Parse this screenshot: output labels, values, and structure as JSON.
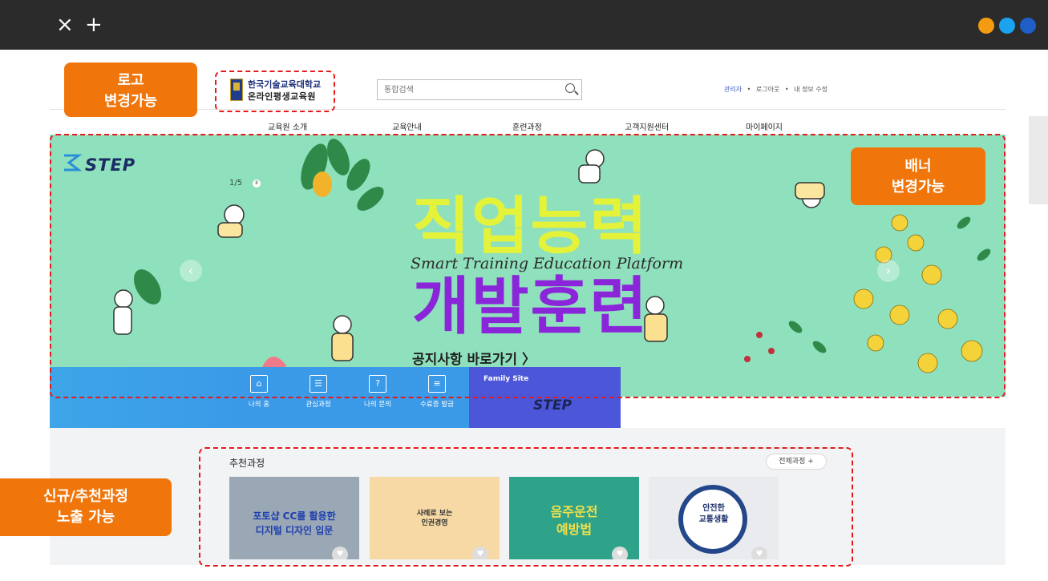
{
  "browser": {
    "close_icon": "×",
    "new_tab_icon": "+",
    "dots": [
      "#f39c12",
      "#1ba3ef",
      "#1e5ec6"
    ]
  },
  "header": {
    "logo_line1": "한국기술교육대학교",
    "logo_line2": "온라인평생교육원",
    "search_placeholder": "통합검색",
    "util_links": [
      "관리자",
      "•",
      "로그아웃",
      "•",
      "내 정보 수정"
    ],
    "gnb": [
      "교육원 소개",
      "교육안내",
      "훈련과정",
      "고객지원센터",
      "마이페이지"
    ]
  },
  "banner": {
    "brand": "STEP",
    "pager": "1/5",
    "pause_icon": "II",
    "prev_icon": "‹",
    "next_icon": "›",
    "headline1": "직업능력",
    "script": "Smart Training Education Platform",
    "headline2": "개발훈련",
    "notice_link": "공지사항 바로가기 〉"
  },
  "quick_menu": {
    "items": [
      {
        "label": "나의 홈",
        "icon": "home-icon",
        "glyph": "⌂"
      },
      {
        "label": "관심과정",
        "icon": "bookmark-icon",
        "glyph": "☰"
      },
      {
        "label": "나의 문의",
        "icon": "question-icon",
        "glyph": "?"
      },
      {
        "label": "수료증 발급",
        "icon": "certificate-icon",
        "glyph": "≡"
      }
    ],
    "family_title": "Family Site",
    "family_logo": "STEP"
  },
  "recommend": {
    "title": "추천과정",
    "all_button": "전체과정 +",
    "cards": [
      {
        "line1": "포토샵 CC를 활용한",
        "line2": "디지털 디자인 입문",
        "bg": "#9aa7b5"
      },
      {
        "line1": "사례로 보는",
        "line2": "인권경영",
        "bg": "#f6d9a4"
      },
      {
        "line1": "음주운전",
        "line2": "예방법",
        "bg": "#2fa38a"
      },
      {
        "line1": "안전한",
        "line2": "교통생활",
        "bg": "#e9ebee"
      }
    ]
  },
  "annotations": {
    "logo": [
      "로고",
      "변경가능"
    ],
    "banner": [
      "배너",
      "변경가능"
    ],
    "recommend": [
      "신규/추천과정",
      "노출 가능"
    ]
  }
}
